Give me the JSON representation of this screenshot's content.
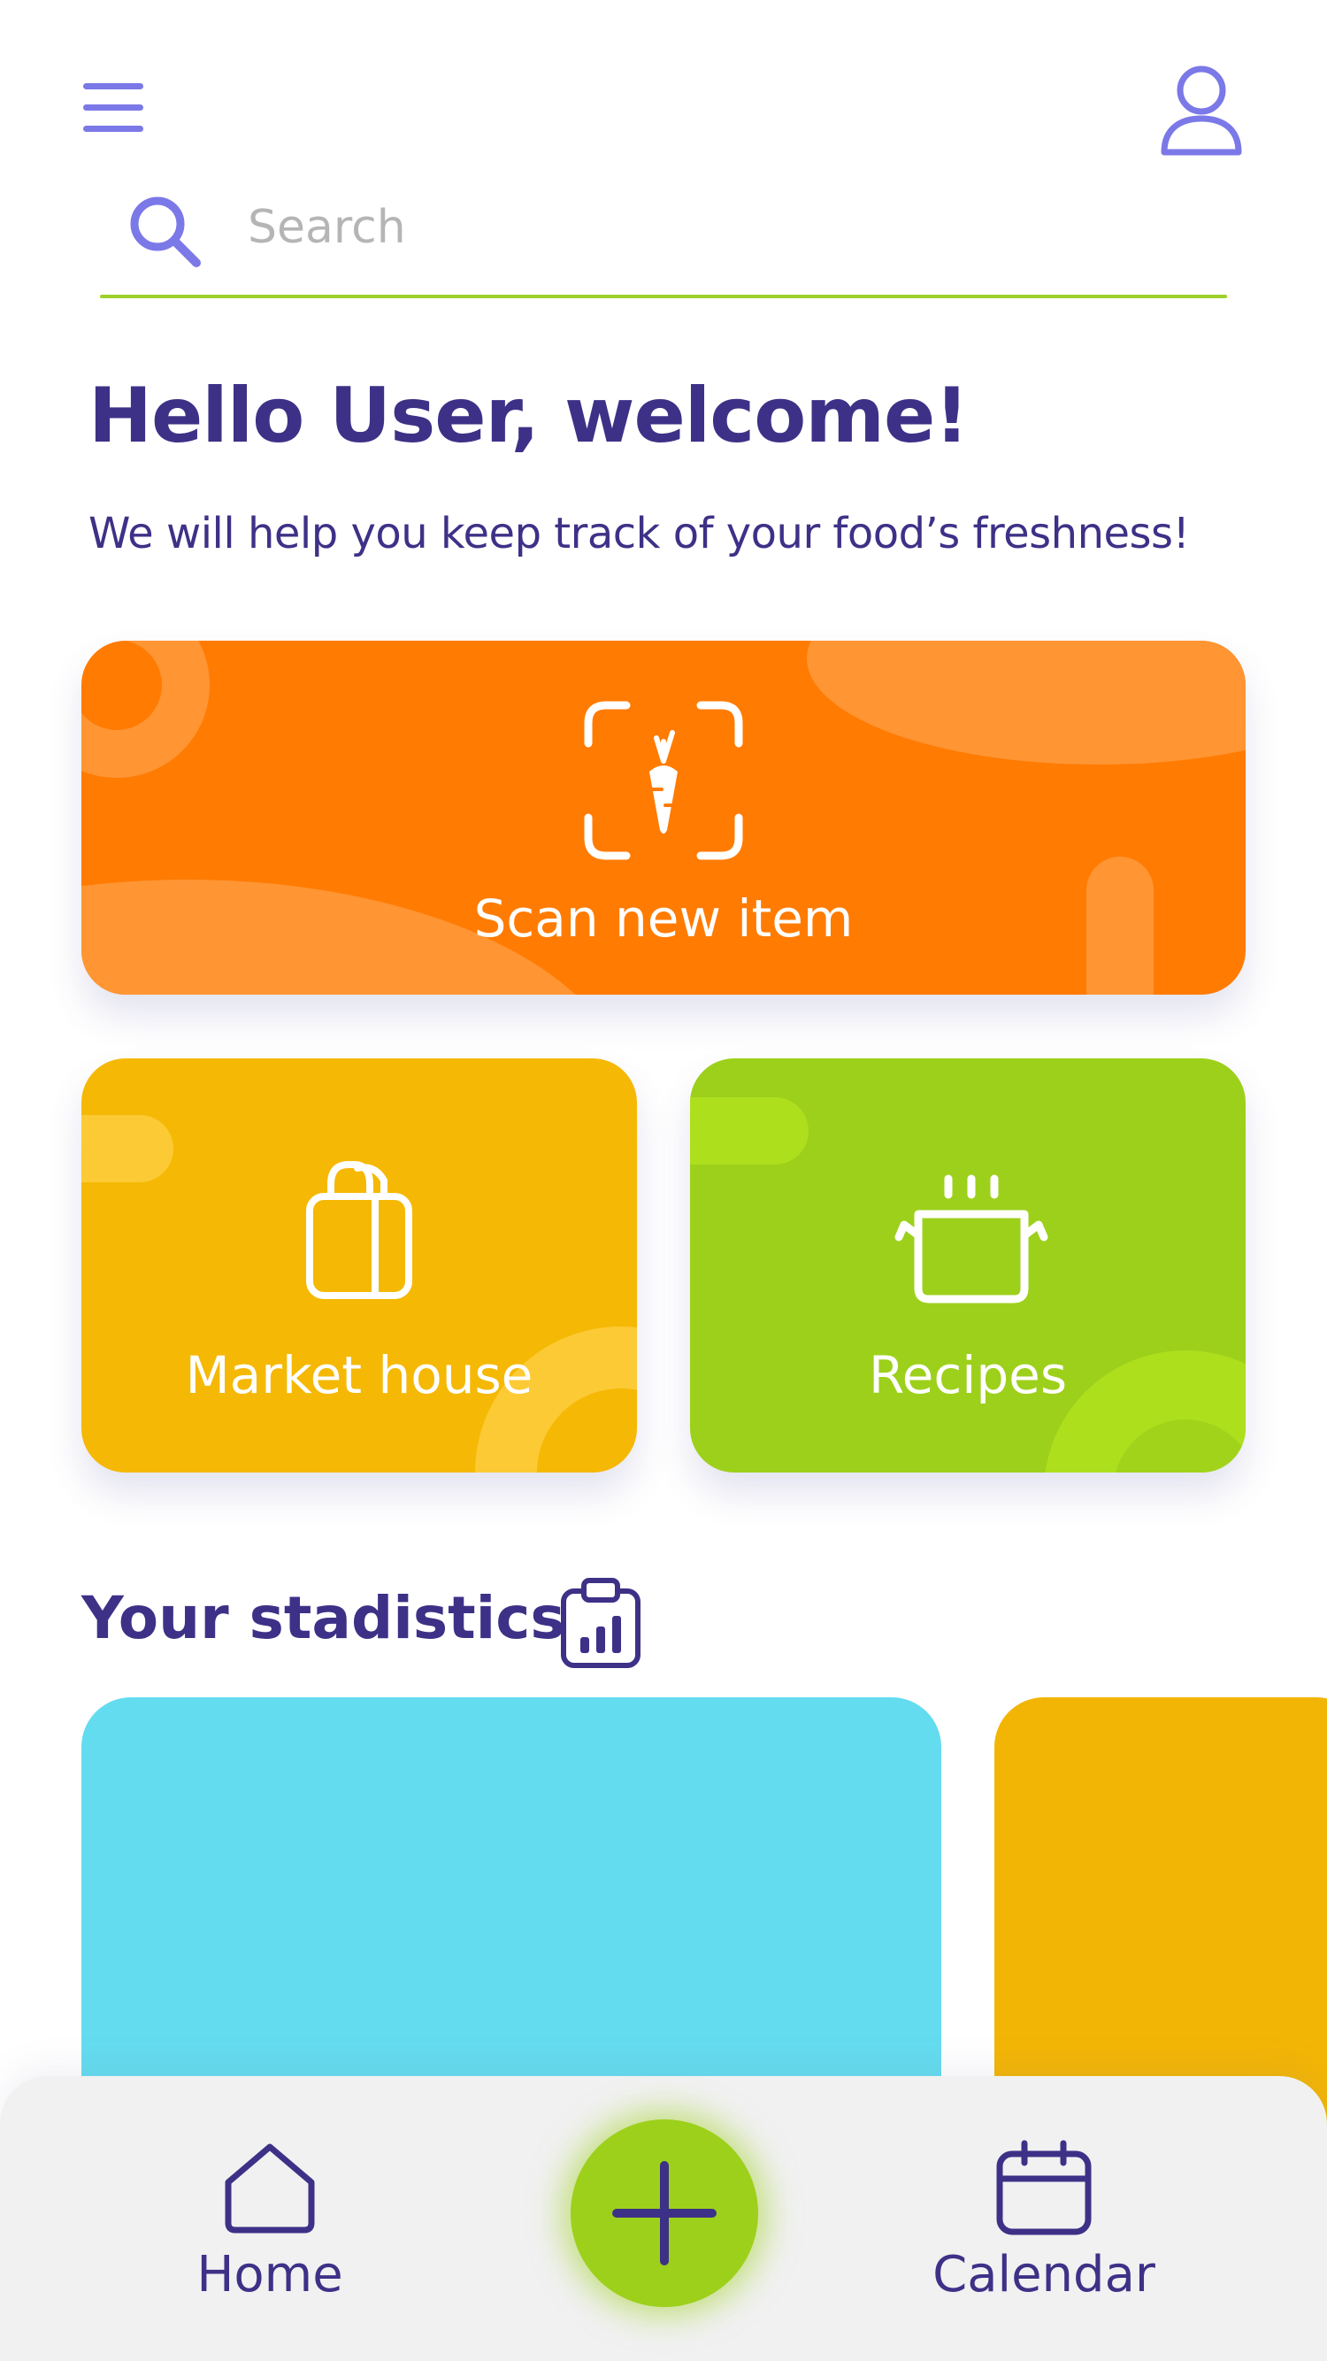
{
  "header": {
    "menu_icon": "hamburger-menu-icon",
    "profile_icon": "user-icon"
  },
  "search": {
    "placeholder": "Search",
    "value": ""
  },
  "greeting": {
    "title": "Hello User, welcome!",
    "subtitle": "We will help you keep track of your food’s freshness!"
  },
  "cards": {
    "scan": {
      "label": "Scan new item",
      "icon": "scan-carrot-icon",
      "color": "#ff7b02"
    },
    "market": {
      "label": "Market house",
      "icon": "shopping-bag-icon",
      "color": "#f5b804"
    },
    "recipes": {
      "label": "Recipes",
      "icon": "cooking-pot-icon",
      "color": "#9dd01b"
    }
  },
  "statistics": {
    "title": "Your stadistics",
    "icon": "clipboard-chart-icon",
    "card_colors": [
      "#64dcef",
      "#f3b505"
    ]
  },
  "bottom_nav": {
    "home_label": "Home",
    "calendar_label": "Calendar",
    "add_icon": "plus-icon",
    "accent": "#9dd01b"
  },
  "colors": {
    "primary_text": "#3d3187",
    "icon_accent": "#7b78e8",
    "underline": "#9dd12a"
  }
}
